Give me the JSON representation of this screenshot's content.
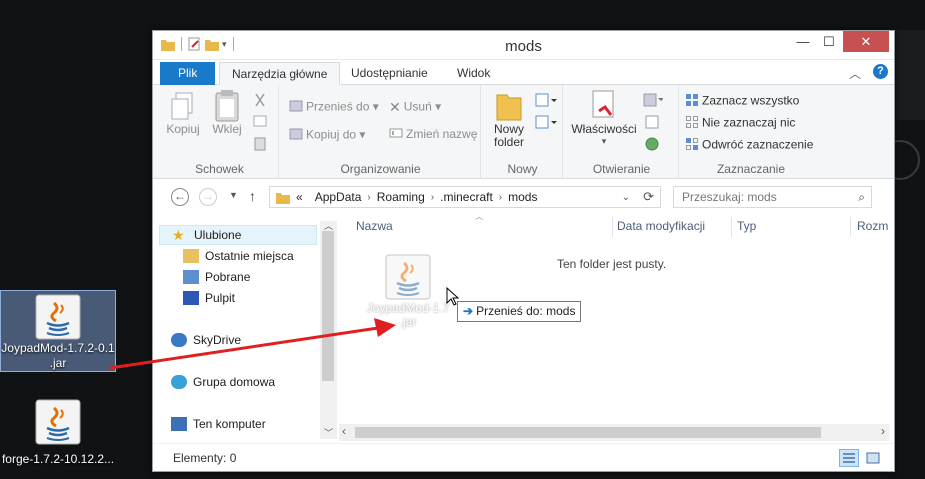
{
  "desktop": {
    "icons": [
      {
        "label": "JoypadMod-1.7.2-0.1.jar",
        "label_line1": "JoypadMod-1.7.2-0.1",
        "label_line2": ".jar",
        "selected": true,
        "icon": "java-icon"
      },
      {
        "label": "forge-1.7.2-10.12.2...",
        "selected": false,
        "icon": "java-icon"
      }
    ]
  },
  "window": {
    "title": "mods",
    "controls": {
      "minimize": "—",
      "maximize": "☐",
      "close": "✕"
    },
    "tabs": [
      {
        "label": "Plik"
      },
      {
        "label": "Narzędzia główne",
        "active": true
      },
      {
        "label": "Udostępnianie"
      },
      {
        "label": "Widok"
      }
    ],
    "ribbon": {
      "clipboard": {
        "group": "Schowek",
        "copy": "Kopiuj",
        "paste": "Wklej"
      },
      "organize": {
        "group": "Organizowanie",
        "move_to": "Przenieś do",
        "copy_to": "Kopiuj do",
        "delete": "Usuń",
        "rename": "Zmień nazwę"
      },
      "new": {
        "group": "Nowy",
        "new_folder_l1": "Nowy",
        "new_folder_l2": "folder"
      },
      "open": {
        "group": "Otwieranie",
        "properties": "Właściwości"
      },
      "select": {
        "group": "Zaznaczanie",
        "select_all": "Zaznacz wszystko",
        "select_none": "Nie zaznaczaj nic",
        "invert": "Odwróć zaznaczenie"
      }
    },
    "address": {
      "overflow": "«",
      "crumbs": [
        "AppData",
        "Roaming",
        ".minecraft",
        "mods"
      ]
    },
    "search": {
      "placeholder": "Przeszukaj: mods"
    },
    "nav": {
      "favorites": "Ulubione",
      "recent": "Ostatnie miejsca",
      "downloads": "Pobrane",
      "desktop": "Pulpit",
      "skydrive": "SkyDrive",
      "homegroup": "Grupa domowa",
      "computer": "Ten komputer"
    },
    "columns": {
      "name": "Nazwa",
      "modified": "Data modyfikacji",
      "type": "Typ",
      "size": "Rozm"
    },
    "empty_message": "Ten folder jest pusty.",
    "drag": {
      "label_line1": "JoypadMod-1.7",
      "label_line2": ".jar",
      "tooltip": "Przenieś do: mods"
    },
    "status": {
      "items": "Elementy: 0"
    }
  },
  "colors": {
    "accent": "#1979ca",
    "close": "#c75050",
    "arrow": "#e02020"
  }
}
